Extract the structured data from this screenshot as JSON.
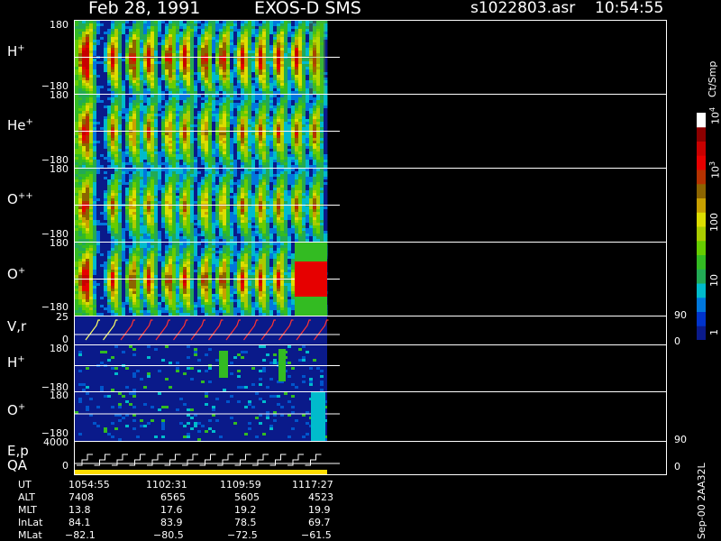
{
  "header": {
    "date": "Feb 28, 1991",
    "instrument": "EXOS-D SMS",
    "file": "s1022803.asr",
    "time": "10:54:55"
  },
  "panels": [
    {
      "id": "h",
      "label_main": "H",
      "label_sup": "+",
      "ymax": "180",
      "ymin": "−180"
    },
    {
      "id": "he",
      "label_main": "He",
      "label_sup": "+",
      "ymax": "180",
      "ymin": "−180"
    },
    {
      "id": "opp",
      "label_main": "O",
      "label_sup": "++",
      "ymax": "180",
      "ymin": "−180"
    },
    {
      "id": "op",
      "label_main": "O",
      "label_sup": "+",
      "ymax": "180",
      "ymin": "−180"
    },
    {
      "id": "vr",
      "label_main": "V,r",
      "label_sup": "",
      "ymax": "25",
      "ymin": "0",
      "rmax": "90",
      "rmin": "0"
    },
    {
      "id": "h2",
      "label_main": "H",
      "label_sup": "+",
      "ymax": "180",
      "ymin": "−180"
    },
    {
      "id": "o2",
      "label_main": "O",
      "label_sup": "+",
      "ymax": "180",
      "ymin": "−180"
    },
    {
      "id": "ep",
      "label_main": "E,p",
      "label_sup": "",
      "label2": "QA",
      "ymax": "4000",
      "ymin": "0",
      "rmax": "90",
      "rmin": "0"
    }
  ],
  "colorbar": {
    "unit": "Ct/Smp",
    "labels": [
      "1",
      "10",
      "100",
      "10",
      "10"
    ],
    "exponents": [
      "",
      "",
      "",
      "3",
      "4"
    ],
    "colors": [
      "#0a1a8a",
      "#0033cc",
      "#0077dd",
      "#00bbcc",
      "#22aa55",
      "#33bb22",
      "#66cc00",
      "#aacc00",
      "#dddd00",
      "#c8a000",
      "#8c6400",
      "#b43200",
      "#e60000",
      "#c80000",
      "#8c0000",
      "#ffffff"
    ]
  },
  "footer": {
    "rows": [
      {
        "name": "UT",
        "values": [
          "1054:55",
          "1102:31",
          "1109:59",
          "1117:27"
        ]
      },
      {
        "name": "ALT",
        "values": [
          "7408",
          "6565",
          "5605",
          "4523"
        ]
      },
      {
        "name": "MLT",
        "values": [
          "13.8",
          "17.6",
          "19.2",
          "19.9"
        ]
      },
      {
        "name": "InLat",
        "values": [
          "84.1",
          "83.9",
          "78.5",
          "69.7"
        ]
      },
      {
        "name": "MLat",
        "values": [
          "−82.1",
          "−80.5",
          "−72.5",
          "−61.5"
        ]
      }
    ],
    "stamp": "Sep-00  2AA32L"
  },
  "chart_data": {
    "type": "heatmap",
    "title": "Feb 28, 1991   EXOS-D SMS",
    "x": [
      "1054:55",
      "1102:31",
      "1109:59",
      "1117:27"
    ],
    "colorbar_unit": "Ct/Smp",
    "colorbar_range": [
      1,
      10000
    ],
    "colorbar_scale": "log",
    "series": [
      {
        "name": "H+",
        "ylim": [
          -180,
          180
        ]
      },
      {
        "name": "He+",
        "ylim": [
          -180,
          180
        ]
      },
      {
        "name": "O++",
        "ylim": [
          -180,
          180
        ]
      },
      {
        "name": "O+",
        "ylim": [
          -180,
          180
        ]
      },
      {
        "name": "V,r",
        "ylim": [
          0,
          25
        ],
        "right_ylim": [
          0,
          90
        ]
      },
      {
        "name": "H+",
        "ylim": [
          -180,
          180
        ]
      },
      {
        "name": "O+",
        "ylim": [
          -180,
          180
        ]
      },
      {
        "name": "E,p",
        "ylim": [
          0,
          4000
        ],
        "right_ylim": [
          0,
          90
        ]
      }
    ]
  }
}
